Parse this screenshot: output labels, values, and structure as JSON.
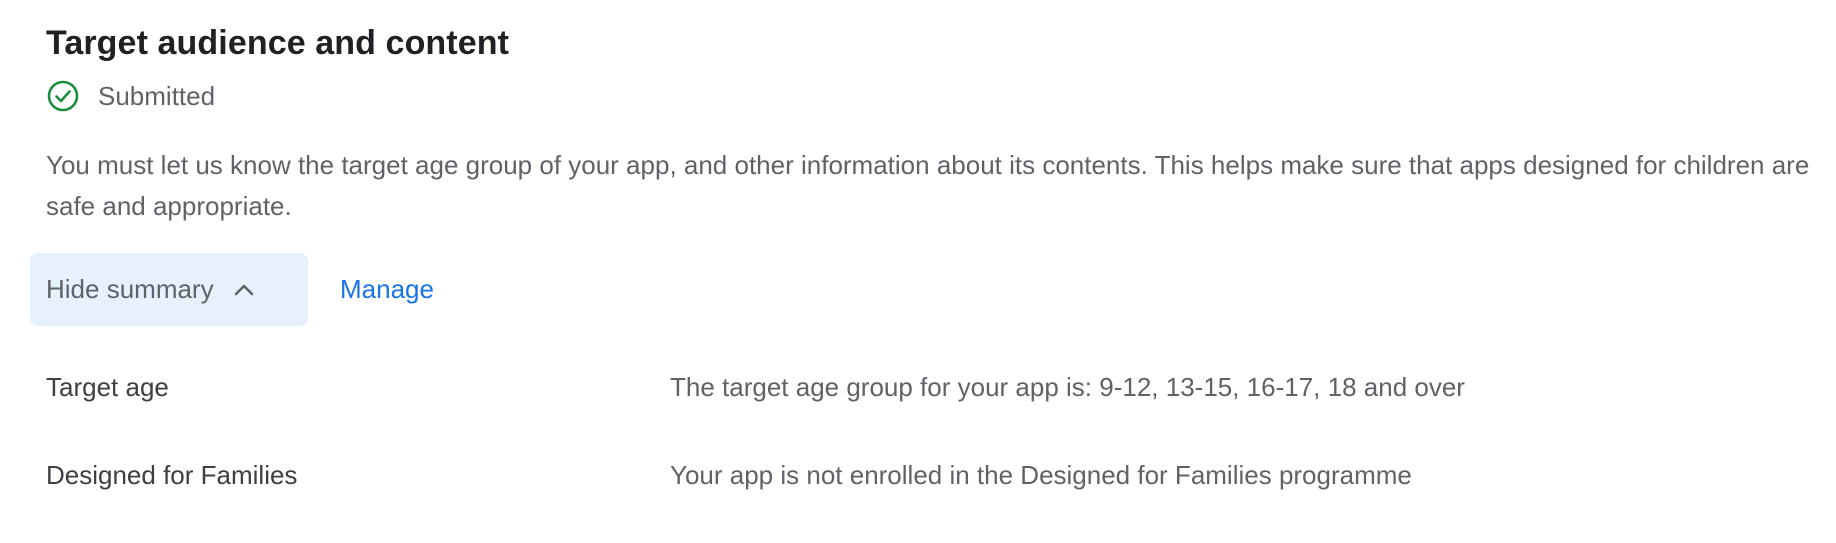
{
  "section": {
    "title": "Target audience and content",
    "status": {
      "label": "Submitted",
      "icon": "check-circle-icon",
      "color": "#1e8e3e"
    },
    "description": "You must let us know the target age group of your app, and other information about its contents. This helps make sure that apps designed for children are safe and appropriate.",
    "actions": {
      "toggle_label": "Hide summary",
      "toggle_icon": "chevron-up-icon",
      "manage_label": "Manage",
      "accent_color": "#1a73e8",
      "toggle_background": "#e8f0fe"
    },
    "summary": [
      {
        "key": "Target age",
        "value": "The target age group for your app is: 9-12, 13-15, 16-17, 18 and over"
      },
      {
        "key": "Designed for Families",
        "value": "Your app is not enrolled in the Designed for Families programme"
      }
    ]
  }
}
